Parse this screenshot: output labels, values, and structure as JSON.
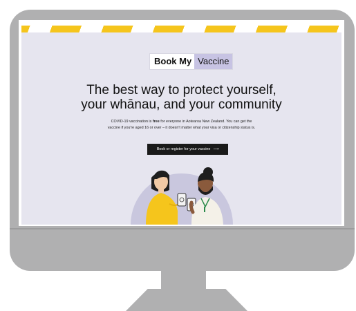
{
  "logo": {
    "part1": "Book My",
    "part2": "Vaccine"
  },
  "hero": {
    "headline_line1": "The best way to protect yourself,",
    "headline_line2": "your whānau, and your community",
    "intro_part1": "COVID-19 vaccination is ",
    "intro_bold": "free",
    "intro_part2": " for everyone in Aotearoa New Zealand. You can get the",
    "intro_line2": "vaccine if you're aged 16 or over – it doesn't matter what your visa or citizenship status is.",
    "cta_label": "Book or register for your vaccine",
    "cta_arrow": "⟶"
  },
  "colors": {
    "stripe_yellow": "#f5c51c",
    "page_bg": "#e6e5ef",
    "logo_accent": "#c7c3e3",
    "button_bg": "#1a1a1a",
    "monitor": "#b0b0b1"
  }
}
